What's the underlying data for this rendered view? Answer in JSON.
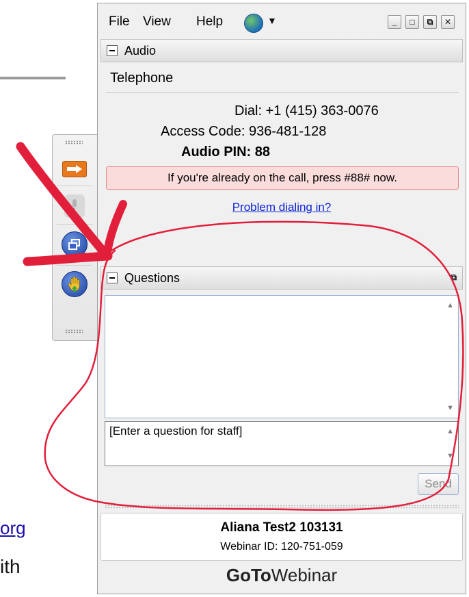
{
  "background": {
    "link_fragment": "org",
    "text_fragment": "ith"
  },
  "menubar": {
    "items": [
      "File",
      "View",
      "Help"
    ],
    "language_icon": "globe-icon",
    "window_buttons": [
      "minimize",
      "maximize",
      "popout",
      "close"
    ]
  },
  "audio": {
    "title": "Audio",
    "mode": "Telephone",
    "dial_label": "Dial:",
    "dial_value": "+1 (415) 363-0076",
    "access_label": "Access Code:",
    "access_value": "936-481-128",
    "pin_label": "Audio PIN:",
    "pin_value": "88",
    "alert": "If you're already on the call, press #88# now.",
    "problem_link": "Problem dialing in?"
  },
  "questions": {
    "title": "Questions",
    "input_placeholder": "[Enter a question for staff]",
    "send_label": "Send"
  },
  "user": {
    "name": "Aliana Test2 103131",
    "webinar_id_label": "Webinar ID:",
    "webinar_id": "120-751-059"
  },
  "brand": {
    "bold": "GoTo",
    "regular": "Webinar"
  },
  "colors": {
    "alert_bg": "#fbdcdc",
    "link": "#0a1fd6",
    "orange_button": "#e8781e",
    "annotation_red": "#e21f3b"
  }
}
